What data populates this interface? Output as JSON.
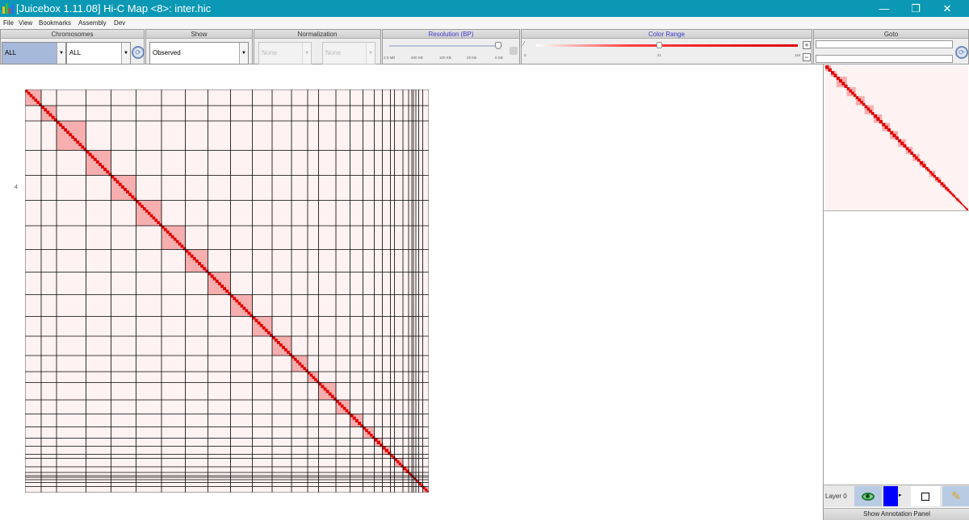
{
  "window": {
    "title": "[Juicebox 1.11.08] Hi-C Map <8>: inter.hic",
    "minimize": "—",
    "restore": "❐",
    "close": "✕"
  },
  "menu": [
    "File",
    "View",
    "Bookmarks",
    "Assembly",
    "Dev"
  ],
  "toolbar": {
    "chromosomes": {
      "label": "Chromosomes",
      "first": "ALL",
      "second": "ALL"
    },
    "show": {
      "label": "Show",
      "value": "Observed"
    },
    "normalization": {
      "label": "Normalization",
      "first": "None",
      "second": "None"
    },
    "resolution": {
      "label": "Resolution (BP)",
      "ticks": [
        "2.5 MB",
        "500 KB",
        "100 KB",
        "25 KB",
        "5 KB"
      ],
      "value_index": 4
    },
    "color_range": {
      "label": "Color Range",
      "min": "0",
      "mid": "41",
      "max": "164",
      "plus": "+",
      "minus": "−"
    },
    "goto": {
      "label": "Goto",
      "first": "",
      "second": ""
    }
  },
  "heatmap": {
    "boundaries": [
      0.04,
      0.078,
      0.151,
      0.213,
      0.275,
      0.338,
      0.397,
      0.453,
      0.509,
      0.563,
      0.612,
      0.66,
      0.7,
      0.727,
      0.77,
      0.805,
      0.837,
      0.865,
      0.885,
      0.905,
      0.915,
      0.936,
      0.95,
      0.958,
      0.962,
      0.968,
      0.975,
      0.985,
      1.0
    ]
  },
  "y_marker": "4",
  "annotation": {
    "layer_label": "Layer 0",
    "color": "#0000ff",
    "show_panel": "Show Annotation Panel"
  },
  "colors": {
    "titlebar": "#0a98b5",
    "contact_red": "#e00000",
    "grid_black": "#000000"
  }
}
